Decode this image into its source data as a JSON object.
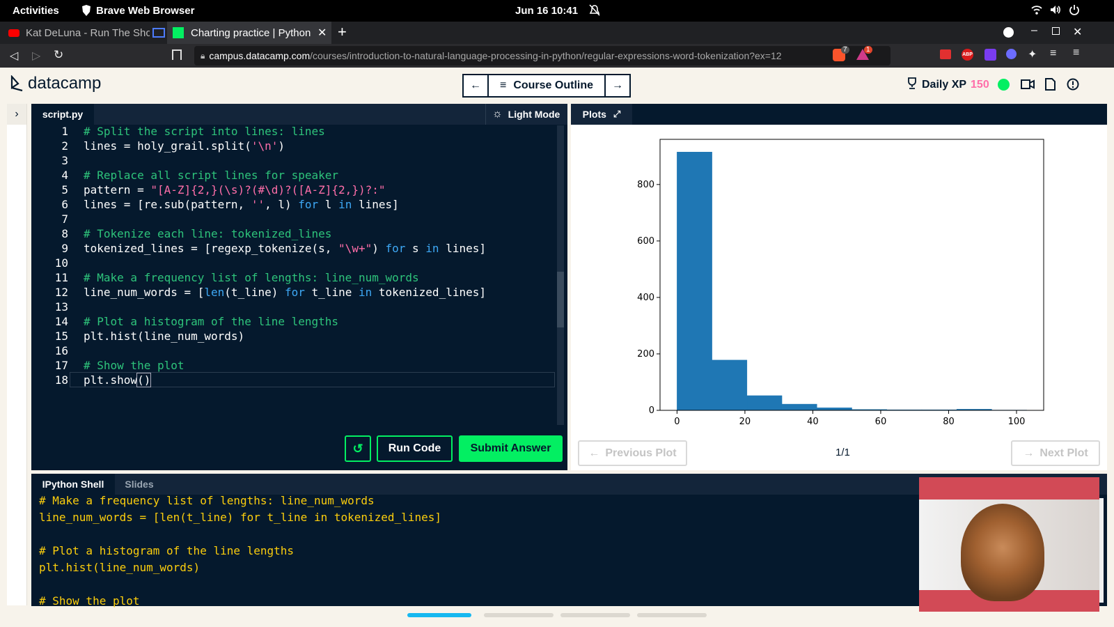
{
  "system": {
    "activities": "Activities",
    "app_name": "Brave Web Browser",
    "clock": "Jun 16  10:41"
  },
  "browser": {
    "tabs": [
      {
        "label": "Kat DeLuna - Run The Show"
      },
      {
        "label": "Charting practice | Python"
      }
    ],
    "url_host": "campus.datacamp.com",
    "url_path": "/courses/introduction-to-natural-language-processing-in-python/regular-expressions-word-tokenization?ex=12",
    "shield_badge": "7",
    "alert_badge": "1"
  },
  "header": {
    "logo": "datacamp",
    "course_outline": "Course Outline",
    "daily_xp_label": "Daily XP",
    "daily_xp_value": "150"
  },
  "editor": {
    "filename": "script.py",
    "light_mode": "Light Mode",
    "line_numbers": [
      "1",
      "2",
      "3",
      "4",
      "5",
      "6",
      "7",
      "8",
      "9",
      "10",
      "11",
      "12",
      "13",
      "14",
      "15",
      "16",
      "17",
      "18"
    ],
    "code": {
      "l1": "# Split the script into lines: lines",
      "l2a": "lines = holy_grail.split(",
      "l2b": "'\\n'",
      "l2c": ")",
      "l4": "# Replace all script lines for speaker",
      "l5a": "pattern = ",
      "l5b": "\"[A-Z]{2,}(\\s)?(#\\d)?([A-Z]{2,})?:\"",
      "l6a": "lines = [re.sub(pattern, ",
      "l6b": "''",
      "l6c": ", l) ",
      "l6d": "for",
      "l6e": " l ",
      "l6f": "in",
      "l6g": " lines]",
      "l8": "# Tokenize each line: tokenized_lines",
      "l9a": "tokenized_lines = [regexp_tokenize(s, ",
      "l9b": "\"\\w+\"",
      "l9c": ") ",
      "l9d": "for",
      "l9e": " s ",
      "l9f": "in",
      "l9g": " lines]",
      "l11": "# Make a frequency list of lengths: line_num_words",
      "l12a": "line_num_words = [",
      "l12b": "len",
      "l12c": "(t_line) ",
      "l12d": "for",
      "l12e": " t_line ",
      "l12f": "in",
      "l12g": " tokenized_lines]",
      "l14": "# Plot a histogram of the line lengths",
      "l15": "plt.hist(line_num_words)",
      "l17": "# Show the plot",
      "l18a": "plt.show",
      "l18b": "()"
    },
    "run_code": "Run Code",
    "submit_answer": "Submit Answer"
  },
  "plots": {
    "tab_label": "Plots",
    "previous": "Previous Plot",
    "next": "Next Plot",
    "pager": "1/1"
  },
  "chart_data": {
    "type": "bar",
    "xlim": [
      -5,
      108
    ],
    "ylim": [
      0,
      960
    ],
    "xticks": [
      "0",
      "20",
      "40",
      "60",
      "80",
      "100"
    ],
    "xtick_values": [
      0,
      20,
      40,
      60,
      80,
      100
    ],
    "yticks": [
      "0",
      "200",
      "400",
      "600",
      "800"
    ],
    "ytick_values": [
      0,
      200,
      400,
      600,
      800
    ],
    "bin_edges": [
      0,
      10.3,
      20.6,
      30.9,
      41.2,
      51.5,
      61.8,
      72.1,
      82.4,
      92.7,
      103
    ],
    "values": [
      915,
      178,
      52,
      22,
      9,
      3,
      2,
      2,
      4,
      1
    ],
    "bar_color": "#1f77b4",
    "grid": false
  },
  "shell": {
    "tabs": [
      "IPython Shell",
      "Slides"
    ],
    "lines": [
      "# Make a frequency list of lengths: line_num_words",
      "line_num_words = [len(t_line) for t_line in tokenized_lines]",
      "",
      "# Plot a histogram of the line lengths",
      "plt.hist(line_num_words)",
      "",
      "# Show the plot"
    ]
  },
  "colors": {
    "navy": "#05192d",
    "green": "#03ef62",
    "pink": "#ff6ea9",
    "comment": "#2ec47b",
    "keyword": "#3ea8f5",
    "shell_text": "#fcce0d"
  }
}
